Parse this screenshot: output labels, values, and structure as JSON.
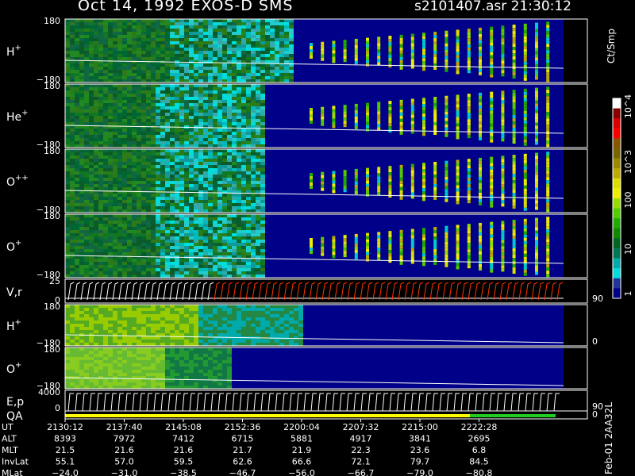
{
  "header": {
    "title": "Oct 14, 1992    EXOS-D SMS",
    "file_time": "s2101407.asr  21:30:12"
  },
  "colorbar": {
    "unit": "Ct/Smp",
    "labels": [
      "10^4",
      "10^3",
      "100",
      "10",
      "1"
    ],
    "colors": [
      "#ffffff",
      "#880000",
      "#dd0000",
      "#ff0000",
      "#885500",
      "#776600",
      "#998800",
      "#bbaa00",
      "#dddd00",
      "#eeee00",
      "#99dd00",
      "#55cc00",
      "#22aa00",
      "#118800",
      "#006622",
      "#007755",
      "#00aaaa",
      "#00dddd",
      "#223399",
      "#000088"
    ]
  },
  "footer_right": "Feb-01 2AA32L",
  "chart_data": {
    "type": "heatmap",
    "time_axis": {
      "label": "UT",
      "ticks": [
        "2130:12",
        "2137:40",
        "2145:08",
        "2152:36",
        "2200:04",
        "2207:32",
        "2215:00",
        "2222:28"
      ]
    },
    "panels": [
      {
        "label": "H",
        "sup": "+",
        "ymax": "180",
        "ymin": "−180",
        "right_label": ""
      },
      {
        "label": "He",
        "sup": "+",
        "ymax": "180",
        "ymin": "−180",
        "right_label": ""
      },
      {
        "label": "O",
        "sup": "++",
        "ymax": "180",
        "ymin": "−180",
        "right_label": ""
      },
      {
        "label": "O",
        "sup": "+",
        "ymax": "180",
        "ymin": "−180",
        "right_label": ""
      },
      {
        "label": "V,r",
        "sup": "",
        "ymax": "25",
        "ymin": "0",
        "right_label": "90"
      },
      {
        "label": "H",
        "sup": "+",
        "ymax": "180",
        "ymin": "−180",
        "right_label": "0"
      },
      {
        "label": "O",
        "sup": "+",
        "ymax": "180",
        "ymin": "−180",
        "right_label": ""
      },
      {
        "label": "E,p",
        "sup": "",
        "ymax": "4000",
        "ymin": "0",
        "right_label": "90"
      },
      {
        "label": "QA",
        "sup": "",
        "ymax": "",
        "ymin": "",
        "right_label": "0"
      }
    ],
    "ephemeris": [
      {
        "name": "UT",
        "values": [
          "2130:12",
          "2137:40",
          "2145:08",
          "2152:36",
          "2200:04",
          "2207:32",
          "2215:00",
          "2222:28"
        ]
      },
      {
        "name": "ALT",
        "values": [
          "8393",
          "7972",
          "7412",
          "6715",
          "5881",
          "4917",
          "3841",
          "2695"
        ]
      },
      {
        "name": "MLT",
        "values": [
          "21.5",
          "21.6",
          "21.6",
          "21.7",
          "21.9",
          "22.3",
          "23.6",
          "6.8"
        ]
      },
      {
        "name": "InvLat",
        "values": [
          "55.1",
          "57.0",
          "59.5",
          "62.6",
          "66.6",
          "72.1",
          "79.7",
          "84.5"
        ]
      },
      {
        "name": "MLat",
        "values": [
          "−24.0",
          "−31.0",
          "−38.5",
          "−46.7",
          "−56.0",
          "−66.7",
          "−79.0",
          "−80.8"
        ]
      }
    ]
  }
}
